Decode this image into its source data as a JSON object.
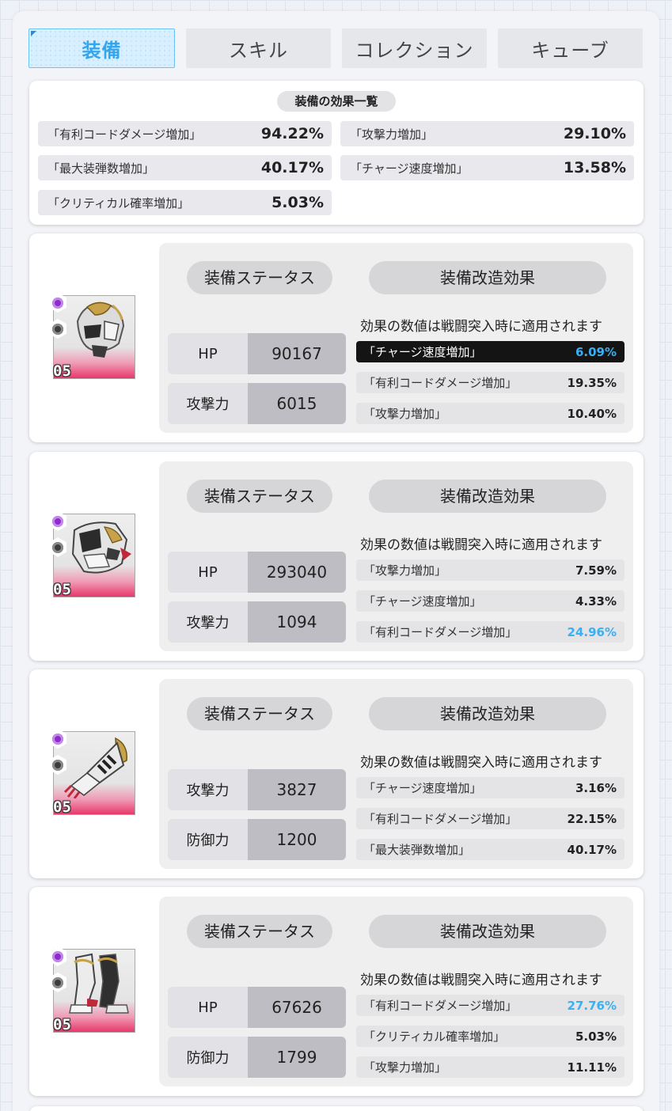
{
  "tabs": [
    {
      "label": "装備",
      "active": true
    },
    {
      "label": "スキル",
      "active": false
    },
    {
      "label": "コレクション",
      "active": false
    },
    {
      "label": "キューブ",
      "active": false
    }
  ],
  "summary": {
    "title": "装備の効果一覧",
    "stats": [
      {
        "name": "「有利コードダメージ増加」",
        "value": "94.22%"
      },
      {
        "name": "「攻撃力増加」",
        "value": "29.10%"
      },
      {
        "name": "「最大装弾数増加」",
        "value": "40.17%"
      },
      {
        "name": "「チャージ速度増加」",
        "value": "13.58%"
      },
      {
        "name": "「クリティカル確率増加」",
        "value": "5.03%"
      }
    ]
  },
  "labels": {
    "status": "装備ステータス",
    "modification": "装備改造効果",
    "note": "効果の数値は戦闘突入時に適用されます"
  },
  "colors": {
    "accent": "#38b0f3",
    "rarity_pink": "#e8386a",
    "highlight_bg": "#141414"
  },
  "equipment": [
    {
      "level": "05",
      "part": "head",
      "stats": [
        {
          "key": "HP",
          "value": "90167"
        },
        {
          "key": "攻撃力",
          "value": "6015"
        }
      ],
      "effects": [
        {
          "name": "「チャージ速度増加」",
          "value": "6.09%",
          "style": "highlight"
        },
        {
          "name": "「有利コードダメージ増加」",
          "value": "19.35%",
          "style": "normal"
        },
        {
          "name": "「攻撃力増加」",
          "value": "10.40%",
          "style": "normal"
        }
      ]
    },
    {
      "level": "05",
      "part": "body",
      "stats": [
        {
          "key": "HP",
          "value": "293040"
        },
        {
          "key": "攻撃力",
          "value": "1094"
        }
      ],
      "effects": [
        {
          "name": "「攻撃力増加」",
          "value": "7.59%",
          "style": "normal"
        },
        {
          "name": "「チャージ速度増加」",
          "value": "4.33%",
          "style": "normal"
        },
        {
          "name": "「有利コードダメージ増加」",
          "value": "24.96%",
          "style": "max"
        }
      ]
    },
    {
      "level": "05",
      "part": "arm",
      "stats": [
        {
          "key": "攻撃力",
          "value": "3827"
        },
        {
          "key": "防御力",
          "value": "1200"
        }
      ],
      "effects": [
        {
          "name": "「チャージ速度増加」",
          "value": "3.16%",
          "style": "normal"
        },
        {
          "name": "「有利コードダメージ増加」",
          "value": "22.15%",
          "style": "normal"
        },
        {
          "name": "「最大装弾数増加」",
          "value": "40.17%",
          "style": "normal"
        }
      ]
    },
    {
      "level": "05",
      "part": "leg",
      "stats": [
        {
          "key": "HP",
          "value": "67626"
        },
        {
          "key": "防御力",
          "value": "1799"
        }
      ],
      "effects": [
        {
          "name": "「有利コードダメージ増加」",
          "value": "27.76%",
          "style": "max"
        },
        {
          "name": "「クリティカル確率増加」",
          "value": "5.03%",
          "style": "normal"
        },
        {
          "name": "「攻撃力増加」",
          "value": "11.11%",
          "style": "normal"
        }
      ]
    }
  ]
}
